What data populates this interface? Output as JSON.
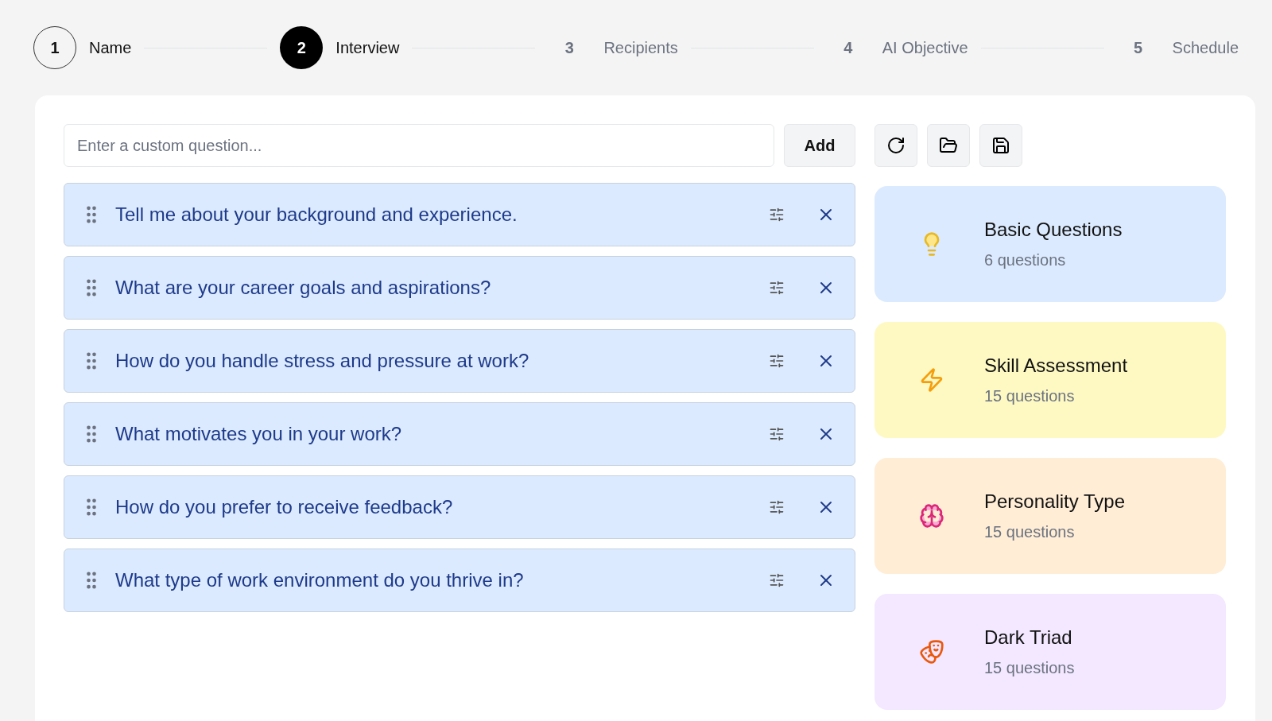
{
  "steps": [
    {
      "number": "1",
      "label": "Name",
      "completed": true,
      "selected": false
    },
    {
      "number": "2",
      "label": "Interview",
      "completed": false,
      "selected": true
    },
    {
      "number": "3",
      "label": "Recipients",
      "completed": false,
      "selected": false
    },
    {
      "number": "4",
      "label": "AI Objective",
      "completed": false,
      "selected": false
    },
    {
      "number": "5",
      "label": "Schedule",
      "completed": false,
      "selected": false
    }
  ],
  "question_input": {
    "placeholder": "Enter a custom question..."
  },
  "add_button": "Add",
  "questions": [
    {
      "text": "Tell me about your background and experience."
    },
    {
      "text": "What are your career goals and aspirations?"
    },
    {
      "text": "How do you handle stress and pressure at work?"
    },
    {
      "text": "What motivates you in your work?"
    },
    {
      "text": "How do you prefer to receive feedback?"
    },
    {
      "text": "What type of work environment do you thrive in?"
    }
  ],
  "question_sets": [
    {
      "kind": "bulb",
      "title": "Basic Questions",
      "count": "6 questions",
      "color": "#dbeafe"
    },
    {
      "kind": "bolt",
      "title": "Skill Assessment",
      "count": "15 questions",
      "color": "#fef9c3"
    },
    {
      "kind": "brain",
      "title": "Personality Type",
      "count": "15 questions",
      "color": "#ffedd5"
    },
    {
      "kind": "masks",
      "title": "Dark Triad",
      "count": "15 questions",
      "color": "#f3e8ff"
    }
  ]
}
